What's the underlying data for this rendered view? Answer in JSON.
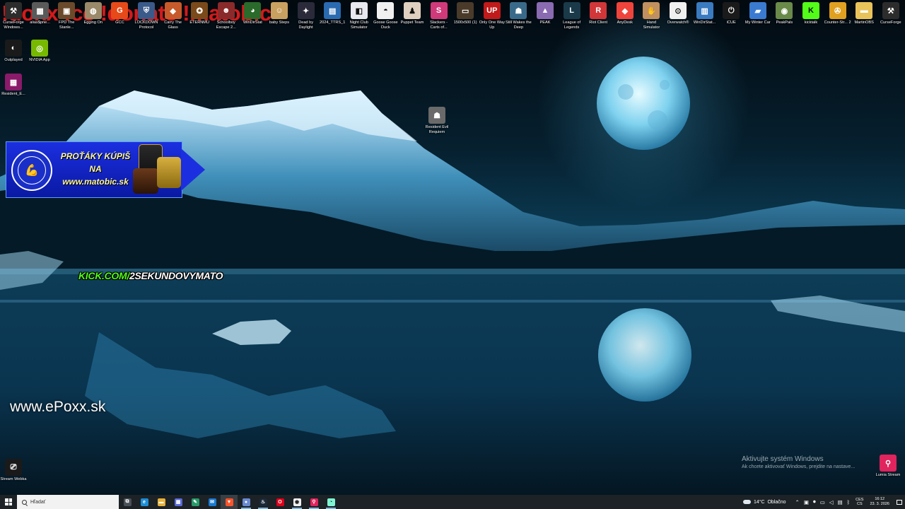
{
  "stream_overlay": {
    "title": "!doxx !cc !donate !matobic",
    "kick_prefix": "KICK.COM/",
    "kick_channel": "2SEKUNDOVYMATO",
    "website": "www.ePoxx.sk"
  },
  "promo_banner": {
    "line1": "PROŤÁKY KÚPIŠ",
    "line2": "NA",
    "line3": "www.matobic.sk"
  },
  "desktop_icons_top": [
    {
      "label": "CurseForge Windows...",
      "icon": "curseforge-icon",
      "color": "#2c2c2c",
      "glyph": "⚒"
    },
    {
      "label": "alias$pne...",
      "icon": "app-icon",
      "color": "#5a5a5a",
      "glyph": "▦"
    },
    {
      "label": "FPD The Stanle...",
      "icon": "game-icon",
      "color": "#6a4a2a",
      "glyph": "▣"
    },
    {
      "label": "Egging On",
      "icon": "game-icon",
      "color": "#9a8a6a",
      "glyph": "◍"
    },
    {
      "label": "GCC",
      "icon": "gcc-icon",
      "color": "#e64a19",
      "glyph": "G"
    },
    {
      "label": "LOCKDOWN Protocol",
      "icon": "game-icon",
      "color": "#3a5a8a",
      "glyph": "⛨"
    },
    {
      "label": "Carry The Glass",
      "icon": "game-icon",
      "color": "#c75a2a",
      "glyph": "◆"
    },
    {
      "label": "ETERNMU",
      "icon": "game-icon",
      "color": "#7a4a1a",
      "glyph": "✪"
    },
    {
      "label": "Schoolboy Escape 2...",
      "icon": "game-icon",
      "color": "#8a2a2a",
      "glyph": "☻"
    },
    {
      "label": "WinDirStat",
      "icon": "windirstat-icon",
      "color": "#2a6a2a",
      "glyph": "◕"
    },
    {
      "label": "baby Steps",
      "icon": "game-icon",
      "color": "#c8a060",
      "glyph": "☺"
    },
    {
      "label": "Dead by Daylight",
      "icon": "game-icon",
      "color": "#2a2a3a",
      "glyph": "✦"
    },
    {
      "label": "2024_TTRS_1",
      "icon": "file-icon",
      "color": "#2a6ab0",
      "glyph": "▤"
    },
    {
      "label": "Night Club Simulator",
      "icon": "game-icon",
      "color": "#e8e8f0",
      "glyph": "◧"
    },
    {
      "label": "Goose Goose Duck",
      "icon": "game-icon",
      "color": "#f0f0f0",
      "glyph": "◓"
    },
    {
      "label": "Puppet Team",
      "icon": "game-icon",
      "color": "#e0d0c0",
      "glyph": "♟"
    },
    {
      "label": "Slackers - Carts of...",
      "icon": "game-icon",
      "color": "#d03a7a",
      "glyph": "S"
    },
    {
      "label": "1500x500 (1)",
      "icon": "image-icon",
      "color": "#4a3a2a",
      "glyph": "▭"
    },
    {
      "label": "Only One Way Up",
      "icon": "game-icon",
      "color": "#c01a1a",
      "glyph": "UP"
    },
    {
      "label": "Still Wakes the Deep",
      "icon": "game-icon",
      "color": "#3a6a8a",
      "glyph": "☗"
    },
    {
      "label": "PEAK",
      "icon": "game-icon",
      "color": "#8a6ab0",
      "glyph": "▲"
    },
    {
      "label": "League of Legends",
      "icon": "lol-icon",
      "color": "#1a3a4a",
      "glyph": "L"
    },
    {
      "label": "Riot Client",
      "icon": "riot-icon",
      "color": "#d13639",
      "glyph": "R"
    },
    {
      "label": "AnyDesk",
      "icon": "anydesk-icon",
      "color": "#ef443b",
      "glyph": "◆"
    },
    {
      "label": "Hand Simulator",
      "icon": "game-icon",
      "color": "#c09060",
      "glyph": "✋"
    },
    {
      "label": "Overwatch®",
      "icon": "overwatch-icon",
      "color": "#f0f0f0",
      "glyph": "⊙"
    },
    {
      "label": "WinDirStat...",
      "icon": "windirstat-icon",
      "color": "#3a7ac0",
      "glyph": "▥"
    },
    {
      "label": "iCUE",
      "icon": "icue-icon",
      "color": "#1a1a1a",
      "glyph": "⏻"
    },
    {
      "label": "My Winter Car",
      "icon": "game-icon",
      "color": "#3a7ad0",
      "glyph": "▰"
    },
    {
      "label": "PeakPals",
      "icon": "game-icon",
      "color": "#6a8a4a",
      "glyph": "◉"
    },
    {
      "label": "kicktalk",
      "icon": "kick-icon",
      "color": "#53fc18",
      "glyph": "K"
    },
    {
      "label": "Counter-Str... 2",
      "icon": "cs2-icon",
      "color": "#e0a020",
      "glyph": "✇"
    },
    {
      "label": "MartinOBS",
      "icon": "folder-icon",
      "color": "#e8c35a",
      "glyph": "▬"
    },
    {
      "label": "CurseForge",
      "icon": "curseforge-icon",
      "color": "#2c2c2c",
      "glyph": "⚒"
    }
  ],
  "desktop_icons_left": [
    {
      "label": "Outplayed",
      "icon": "outplayed-icon",
      "color": "#1a1a1a",
      "glyph": "◐"
    },
    {
      "label": "NVIDIA App",
      "icon": "nvidia-icon",
      "color": "#76b900",
      "glyph": "◎"
    },
    {
      "label": "Resident_E...",
      "icon": "winrar-icon",
      "color": "#8a1a6a",
      "glyph": "▦"
    }
  ],
  "desktop_icons_misc": [
    {
      "label": "Resident Evil Requiem",
      "icon": "resident-evil-icon",
      "color": "#6a6a6a",
      "glyph": "☗"
    },
    {
      "label": "Stream Webka",
      "icon": "webcam-icon",
      "color": "#1a1a1a",
      "glyph": "⎚"
    },
    {
      "label": "Lumia Stream",
      "icon": "lumia-icon",
      "color": "#e0245e",
      "glyph": "⚲"
    }
  ],
  "activation_watermark": {
    "line1": "Aktivujte systém Windows",
    "line2": "Ak chcete aktivovať Windows, prejdite na nastave..."
  },
  "taskbar": {
    "search_placeholder": "Hľadať",
    "apps": [
      {
        "name": "taskview-icon",
        "color": "#4a5058",
        "glyph": "⧉",
        "state": ""
      },
      {
        "name": "edge-icon",
        "color": "#1e8ed6",
        "glyph": "e",
        "state": ""
      },
      {
        "name": "file-explorer-icon",
        "color": "#e8b23a",
        "glyph": "▬",
        "state": ""
      },
      {
        "name": "store-icon",
        "color": "#5a6ad8",
        "glyph": "▦",
        "state": ""
      },
      {
        "name": "copilot-icon",
        "color": "#2a9a6a",
        "glyph": "✎",
        "state": ""
      },
      {
        "name": "mail-icon",
        "color": "#1a7ad0",
        "glyph": "✉",
        "state": ""
      },
      {
        "name": "brave-icon",
        "color": "#fb542b",
        "glyph": "▼",
        "state": "active"
      },
      {
        "name": "app-circle-icon",
        "color": "#6a8ad0",
        "glyph": "●",
        "state": "running"
      },
      {
        "name": "steam-icon",
        "color": "#1b2838",
        "glyph": "♨",
        "state": "running"
      },
      {
        "name": "opera-icon",
        "color": "#e0001b",
        "glyph": "O",
        "state": ""
      },
      {
        "name": "obs-icon",
        "color": "#f0f0f0",
        "glyph": "◉",
        "state": "running"
      },
      {
        "name": "lumia-icon",
        "color": "#e0245e",
        "glyph": "⚲",
        "state": "running"
      },
      {
        "name": "streamlabs-icon",
        "color": "#80f5d2",
        "glyph": "◔",
        "state": "running"
      }
    ],
    "weather": {
      "temp": "14°C",
      "condition": "Oblačno"
    },
    "language": {
      "line1": "CES",
      "line2": "CS"
    },
    "clock": {
      "time": "16:12",
      "date": "23. 3. 2026"
    }
  }
}
